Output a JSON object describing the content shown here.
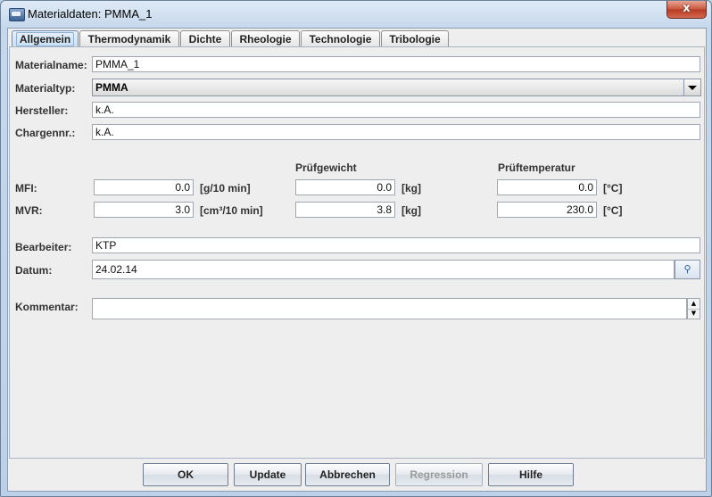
{
  "window": {
    "title": "Materialdaten: PMMA_1",
    "close_label": "x"
  },
  "tabs": [
    {
      "label": "Allgemein",
      "active": true
    },
    {
      "label": "Thermodynamik"
    },
    {
      "label": "Dichte"
    },
    {
      "label": "Rheologie"
    },
    {
      "label": "Technologie"
    },
    {
      "label": "Tribologie"
    }
  ],
  "form": {
    "materialname": {
      "label": "Materialname:",
      "value": "PMMA_1"
    },
    "materialtyp": {
      "label": "Materialtyp:",
      "value": "PMMA"
    },
    "hersteller": {
      "label": "Hersteller:",
      "value": "k.A."
    },
    "chargennr": {
      "label": "Chargennr.:",
      "value": "k.A."
    },
    "headers": {
      "pruefgewicht": "Prüfgewicht",
      "prueftemperatur": "Prüftemperatur"
    },
    "mfi": {
      "label": "MFI:",
      "value": "0.0",
      "unit": "[g/10 min]",
      "gewicht": "0.0",
      "gewicht_unit": "[kg]",
      "temperatur": "0.0",
      "temperatur_unit": "[°C]"
    },
    "mvr": {
      "label": "MVR:",
      "value": "3.0",
      "unit": "[cm³/10 min]",
      "gewicht": "3.8",
      "gewicht_unit": "[kg]",
      "temperatur": "230.0",
      "temperatur_unit": "[°C]"
    },
    "bearbeiter": {
      "label": "Bearbeiter:",
      "value": "KTP"
    },
    "datum": {
      "label": "Datum:",
      "value": "24.02.14"
    },
    "kommentar": {
      "label": "Kommentar:",
      "value": ""
    }
  },
  "buttons": {
    "ok": "OK",
    "update": "Update",
    "abbrechen": "Abbrechen",
    "regression": "Regression",
    "hilfe": "Hilfe"
  }
}
